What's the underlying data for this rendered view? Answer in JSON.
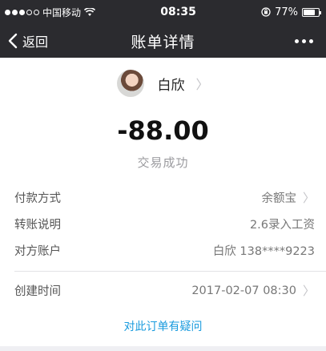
{
  "status_bar": {
    "carrier": "中国移动",
    "time": "08:35",
    "battery": "77%",
    "battery_level": 0.77,
    "signal_dots_filled": 3,
    "signal_dots_total": 5,
    "icons": [
      "signal-icon",
      "wifi-icon",
      "rotation-lock-icon",
      "battery-icon"
    ]
  },
  "nav": {
    "back_label": "返回",
    "title": "账单详情",
    "more_icon": "more-dots-icon"
  },
  "payee": {
    "name": "白欣"
  },
  "amount": "-88.00",
  "transaction_status": "交易成功",
  "details": [
    {
      "label": "付款方式",
      "value": "余额宝",
      "has_chevron": true
    },
    {
      "label": "转账说明",
      "value": "2.6录入工资",
      "has_chevron": false
    },
    {
      "label": "对方账户",
      "value": "白欣 138****9223",
      "has_chevron": false
    }
  ],
  "created": {
    "label": "创建时间",
    "value": "2017-02-07 08:30"
  },
  "question_link": "对此订单有疑问",
  "colors": {
    "header_bg": "#2b2b2f",
    "link": "#1a9bde",
    "muted_text": "#9b9b9f"
  }
}
